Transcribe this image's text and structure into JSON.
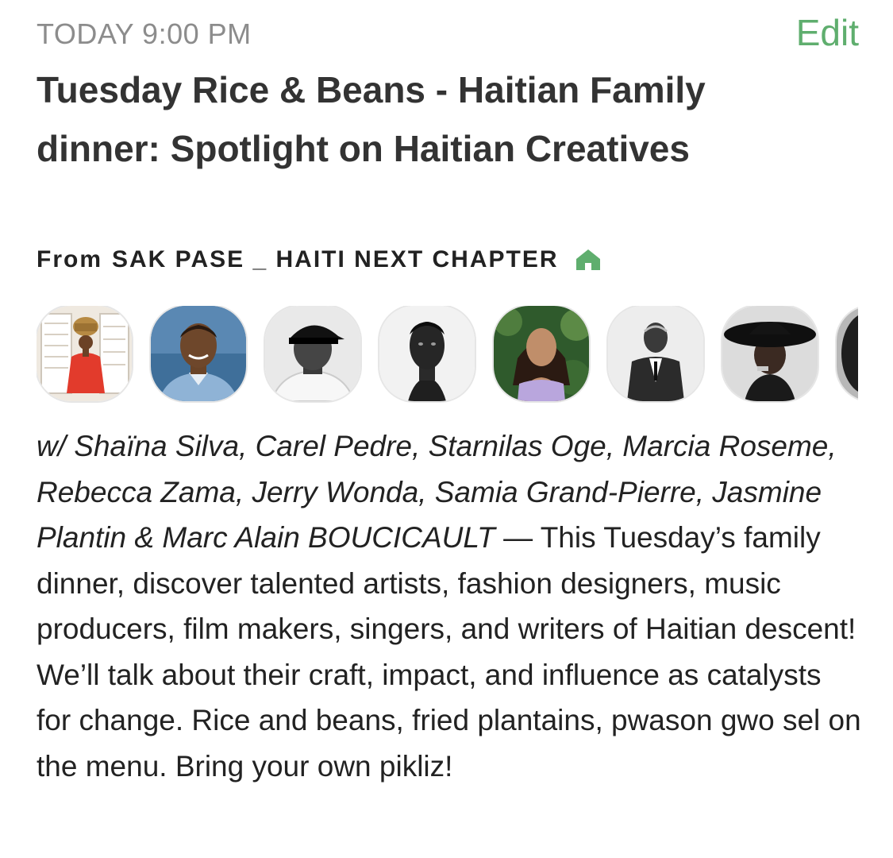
{
  "header": {
    "time": "TODAY 9:00 PM",
    "edit_label": "Edit"
  },
  "event": {
    "title": "Tuesday Rice & Beans - Haitian Family dinner: Spotlight on Haitian Creatives",
    "from_label": "From",
    "club_name": "SAK PASE _ HAITI NEXT CHAPTER",
    "club_icon": "house-icon",
    "speakers_text": "w/ Shaïna Silva, Carel Pedre, Starnilas Oge, Marcia Roseme, Rebecca Zama, Jerry Wonda, Samia Grand-Pierre, Jasmine Plantin & Marc Alain BOUCICAULT",
    "separator": " — ",
    "description": "This Tuesday’s family dinner, discover talented artists, fashion designers, music producers, film makers, singers, and writers of Haitian descent! We’ll talk about their craft, impact, and influence as catalysts for change. Rice and beans, fried plantains, pwason gwo sel on the menu. Bring your own pikliz!"
  },
  "colors": {
    "accent_green": "#5fae6e",
    "muted_gray": "#8c8c8c",
    "title_text": "#333333"
  }
}
